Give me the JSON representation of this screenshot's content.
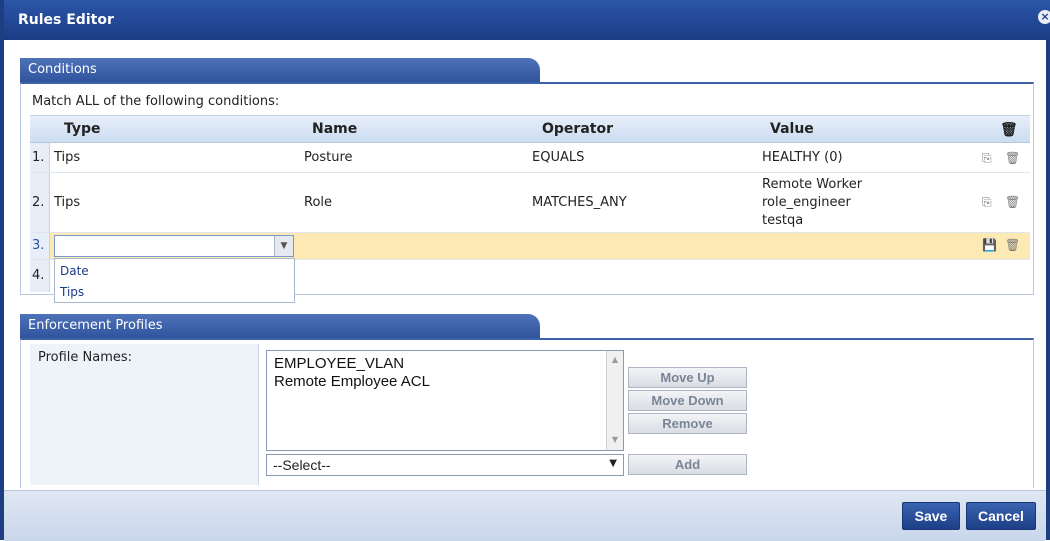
{
  "window": {
    "title": "Rules Editor",
    "close_glyph": "×"
  },
  "conditions": {
    "tab_label": "Conditions",
    "match_text": "Match ALL of the following conditions:",
    "columns": {
      "type": "Type",
      "name": "Name",
      "operator": "Operator",
      "value": "Value"
    },
    "rows": [
      {
        "num": "1.",
        "type": "Tips",
        "name": "Posture",
        "operator": "EQUALS",
        "value": [
          "HEALTHY (0)"
        ]
      },
      {
        "num": "2.",
        "type": "Tips",
        "name": "Role",
        "operator": "MATCHES_ANY",
        "value": [
          "Remote Worker",
          "role_engineer",
          "testqa"
        ]
      }
    ],
    "edit_row": {
      "num": "3.",
      "type_value": ""
    },
    "next_row_num": "4.",
    "type_dropdown_options": [
      "Date",
      "Tips"
    ]
  },
  "enforcement": {
    "tab_label": "Enforcement Profiles",
    "profile_label": "Profile Names:",
    "profiles": [
      "EMPLOYEE_VLAN",
      "Remote Employee ACL"
    ],
    "select_value": "--Select--",
    "buttons": {
      "move_up": "Move Up",
      "move_down": "Move Down",
      "remove": "Remove",
      "add": "Add"
    }
  },
  "footer": {
    "save": "Save",
    "cancel": "Cancel"
  },
  "icons": {
    "trash": "🗑",
    "copy": "⎘",
    "save": "💾",
    "combo_arrow": "▼",
    "scroll_up": "▲",
    "scroll_down": "▼",
    "select_arrow": "▼"
  },
  "colors": {
    "titlebar": "#1b3c85",
    "edit_row": "#fde9b3",
    "section_tab": "#3c62a9"
  }
}
